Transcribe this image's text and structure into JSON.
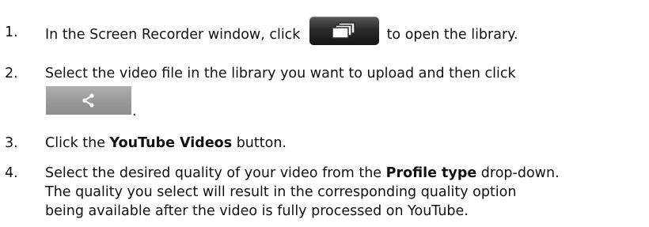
{
  "steps": [
    {
      "number": "1.",
      "text_before": "In the Screen Recorder window, click ",
      "button_icon": "library-icon",
      "text_after": " to open the library."
    },
    {
      "number": "2.",
      "text_before": "Select the video file in the library you want to upload and then click",
      "button_icon": "share-icon",
      "text_after": "."
    },
    {
      "number": "3.",
      "text_before": "Click the ",
      "bold": "YouTube Videos",
      "text_after": " button."
    },
    {
      "number": "4.",
      "text_before": "Select the desired quality of your video from the ",
      "bold": "Profile type",
      "text_after": " drop-down.",
      "line2": "The quality you select will result in the corresponding quality option",
      "line3": "being available after the video is fully processed on YouTube."
    }
  ],
  "colors": {
    "text": "#111111",
    "library_button": "#2b2b2b",
    "share_button": "#9a9a9a"
  }
}
